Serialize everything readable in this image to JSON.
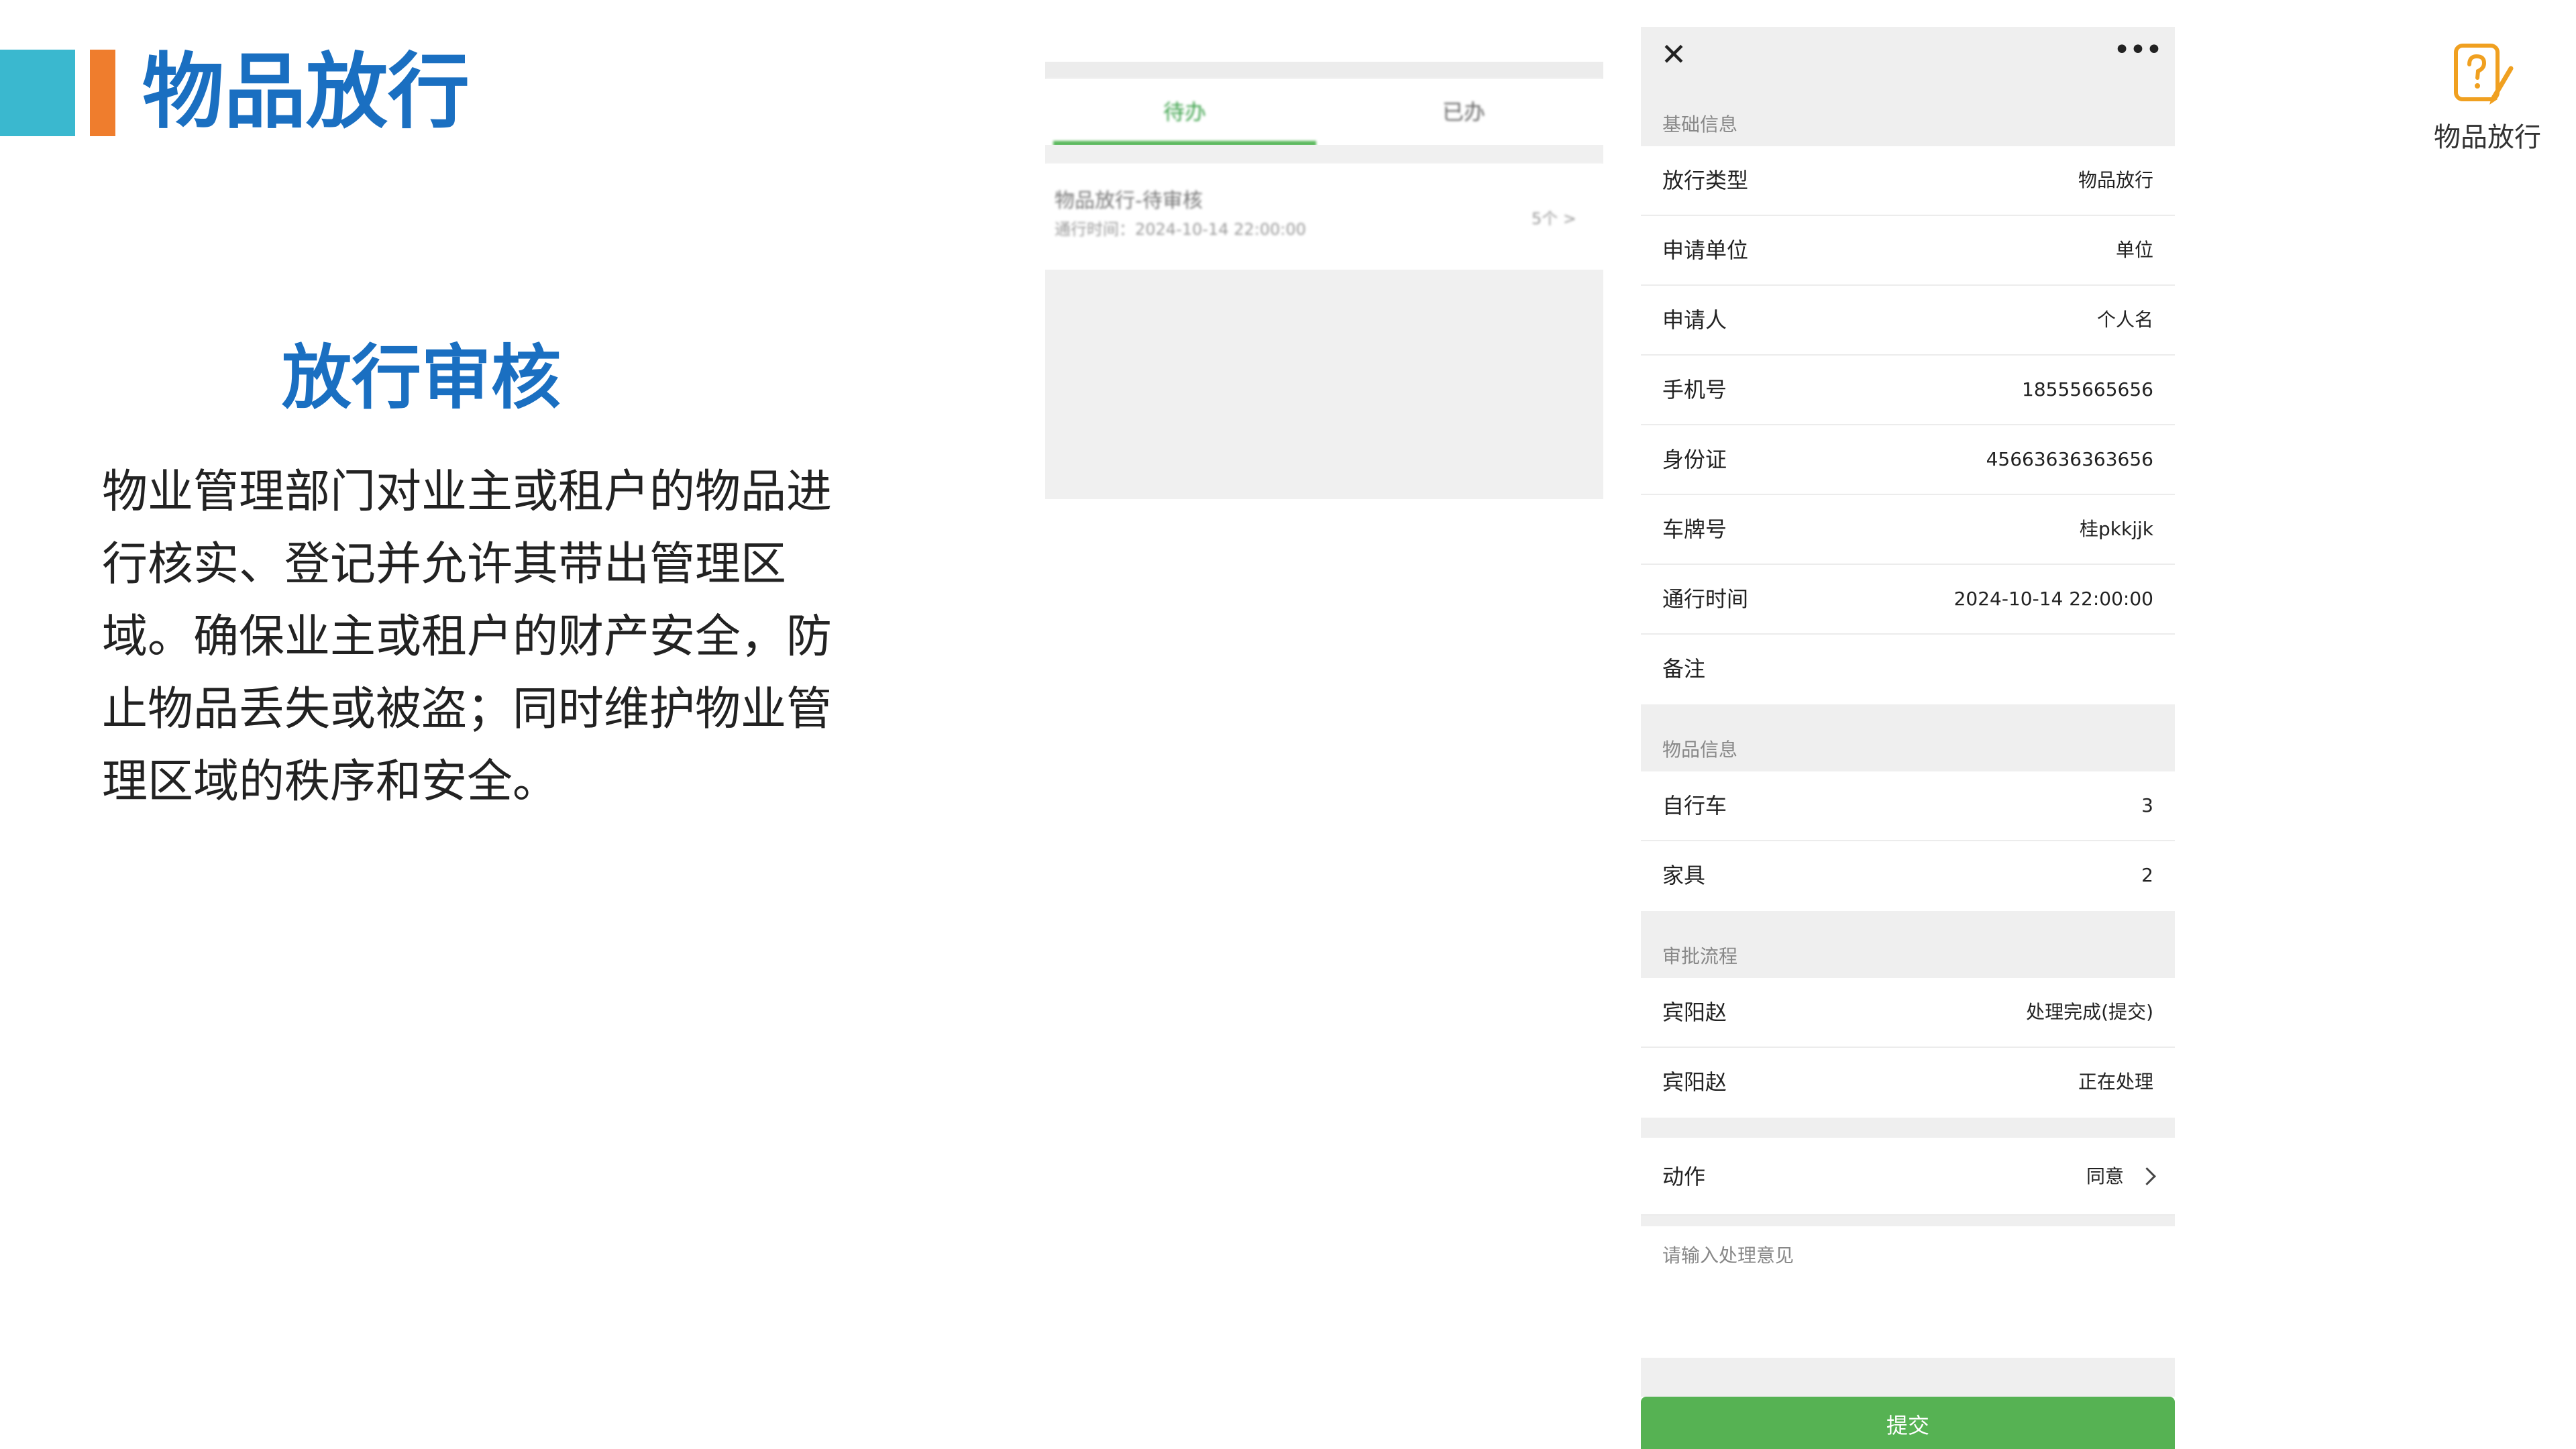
{
  "slide": {
    "title": "物品放行",
    "section_title": "放行审核",
    "description": "物业管理部门对业主或租户的物品进行核实、登记并允许其带出管理区域。确保业主或租户的财产安全，防止物品丢失或被盗；同时维护物业管理区域的秩序和安全。",
    "badge_label": "物品放行",
    "colors": {
      "title_blue": "#1a6fc1",
      "bar_cyan": "#3ab8cf",
      "bar_orange": "#ef7d2d",
      "badge_orange": "#f0a020"
    }
  },
  "list_screen": {
    "tabs": [
      {
        "label": "待办",
        "active": true
      },
      {
        "label": "已办",
        "active": false
      }
    ],
    "item": {
      "title": "物品放行-待审核",
      "subtitle": "通行时间：2024-10-14 22:00:00",
      "count": "5个 >"
    },
    "colors": {
      "active_tab": "#5ab85c"
    }
  },
  "detail_screen": {
    "header": {
      "close_icon": "close-icon",
      "more_icon": "more-icon"
    },
    "basic_section": {
      "title": "基础信息",
      "rows": [
        {
          "label": "放行类型",
          "value": "物品放行"
        },
        {
          "label": "申请单位",
          "value": "单位"
        },
        {
          "label": "申请人",
          "value": "个人名"
        },
        {
          "label": "手机号",
          "value": "18555665656"
        },
        {
          "label": "身份证",
          "value": "45663636363656"
        },
        {
          "label": "车牌号",
          "value": "桂pkkjjk"
        },
        {
          "label": "通行时间",
          "value": "2024-10-14 22:00:00"
        },
        {
          "label": "备注",
          "value": ""
        }
      ]
    },
    "items_section": {
      "title": "物品信息",
      "rows": [
        {
          "label": "自行车",
          "value": "3"
        },
        {
          "label": "家具",
          "value": "2"
        }
      ]
    },
    "approval_section": {
      "title": "审批流程",
      "rows": [
        {
          "label": "宾阳赵",
          "value": "处理完成(提交)"
        },
        {
          "label": "宾阳赵",
          "value": "正在处理"
        }
      ]
    },
    "action": {
      "label": "动作",
      "value": "同意"
    },
    "opinion_placeholder": "请输入处理意见",
    "submit_label": "提交",
    "colors": {
      "submit": "#56b253",
      "section_bg": "#efefef"
    }
  }
}
